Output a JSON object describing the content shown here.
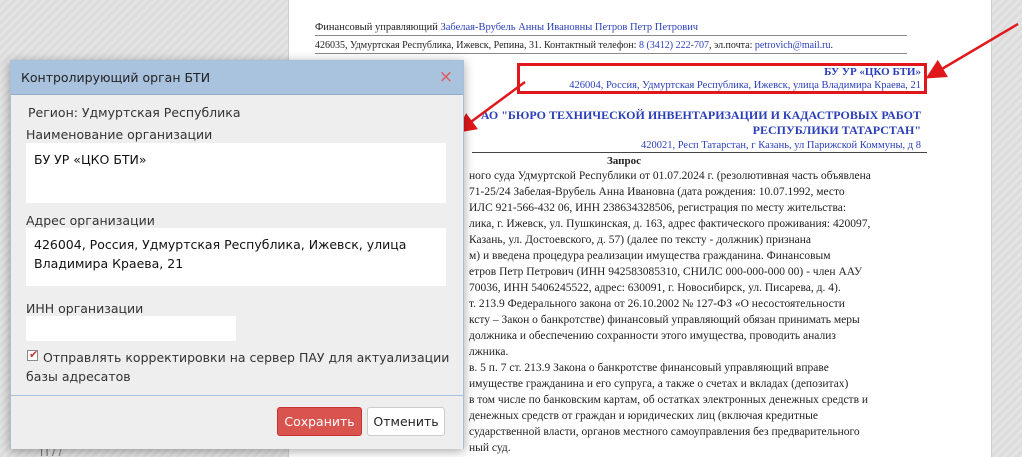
{
  "background_document": {
    "head_line1_prefix": "Финансовый управляющий ",
    "head_line1_name": "Забелая-Врубель Анны Ивановны Петров Петр Петрович",
    "head_line2_prefix": "426035, Удмуртская Республика, Ижевск, Репина, 31. Контактный телефон: ",
    "head_line2_phone": "8 (3412) 222-707",
    "head_line2_mid": ", эл.почта: ",
    "head_line2_email": "petrovich@mail.ru",
    "head_line2_end": ".",
    "addressee1_name": "БУ УР «ЦКО БТИ»",
    "addressee1_address": "426004, Россия, Удмуртская Республика, Ижевск, улица Владимира Краева, 21",
    "addressee2_name": "АО \"БЮРО ТЕХНИЧЕСКОЙ ИНВЕНТАРИЗАЦИИ И КАДАСТРОВЫХ РАБОТ РЕСПУБЛИКИ ТАТАРСТАН\"",
    "addressee2_address": "420021, Респ Татарстан, г Казань, ул Парижской Коммуны, д 8",
    "doc_title": "Запрос",
    "body_lines": [
      "ного суда Удмуртской Республики от 01.07.2024 г. (резолютивная часть объявлена",
      "71-25/24 Забелая-Врубель Анна Ивановна (дата рождения: 10.07.1992, место",
      "ИЛС 921-566-432 06, ИНН 238634328506, регистрация по месту жительства:",
      "лика, г. Ижевск, ул. Пушкинская, д. 163, адрес фактического проживания: 420097,",
      "Казань, ул. Достоевского, д. 57) (далее по тексту - должник) признана",
      "м) и введена процедура реализации имущества гражданина. Финансовым",
      "етров Петр Петрович (ИНН 942583085310, СНИЛС 000-000-000 00) - член ААУ",
      "70036, ИНН 5406245522, адрес: 630091, г. Новосибирск, ул. Писарева, д. 4).",
      "т. 213.9 Федерального закона от 26.10.2002 № 127-ФЗ «О несостоятельности",
      "ксту – Закон о банкротстве) финансовый управляющий обязан принимать меры",
      "должника и обеспечению сохранности этого имущества, проводить анализ",
      "лжника.",
      "в. 5 п. 7 ст. 213.9 Закона о банкротстве финансовый управляющий вправе",
      "имуществе гражданина и его супруга, а также о счетах и вкладах (депозитах)",
      "в том числе по банковским картам, об остатках электронных денежных средств и",
      "денежных средств от граждан и юридических лиц (включая кредитные",
      "сударственной власти, органов местного самоуправления без предварительного",
      "ный суд."
    ],
    "bottom_text": "П                                    /                     /"
  },
  "dialog": {
    "title": "Контролирующий орган БТИ",
    "close_glyph": "×",
    "region": "Регион: Удмуртская Республика",
    "org_name_label": "Наименование организации",
    "org_name_value": "БУ УР «ЦКО БТИ»",
    "org_address_label": "Адрес организации",
    "org_address_value": "426004, Россия, Удмуртская Республика, Ижевск, улица Владимира Краева, 21",
    "inn_label": "ИНН организации",
    "inn_value": "",
    "checkbox_checked": true,
    "checkbox_label": "Отправлять корректировки на сервер ПАУ для актуализации базы адресатов",
    "save_button": "Сохранить",
    "cancel_button": "Отменить"
  },
  "colors": {
    "annotation_red": "#e0181b",
    "dialog_header": "#a9c2de",
    "save_button": "#d9534f",
    "link_blue": "#2a3fb8"
  }
}
